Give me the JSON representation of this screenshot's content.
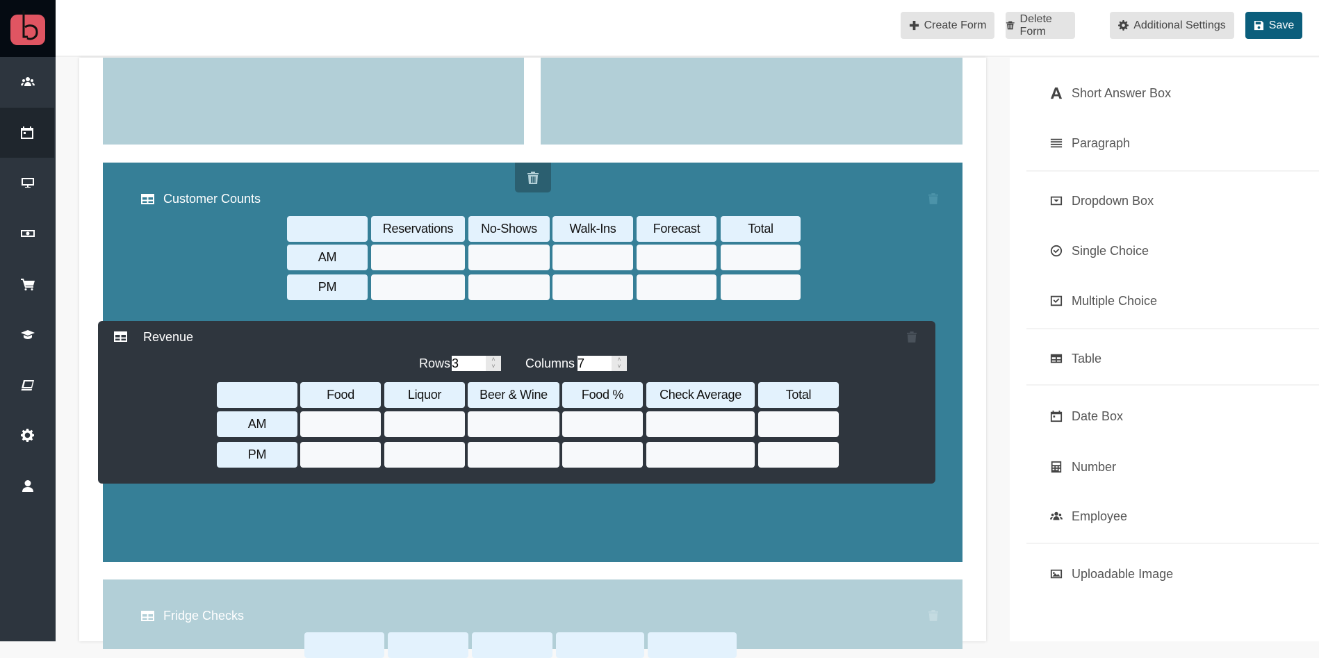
{
  "colors": {
    "sidebar": "#2d353e",
    "logo_bg": "#050b12",
    "brand": "#e05562",
    "primary": "#0b5e7c",
    "block_light": "#b2cfd7",
    "block_active": "#367f97",
    "block_dark": "#2f363e",
    "header_cell": "#e3f2fd"
  },
  "sidebar": {
    "items": [
      {
        "icon": "users-icon"
      },
      {
        "icon": "calendar-icon",
        "active": true
      },
      {
        "icon": "monitor-icon"
      },
      {
        "icon": "money-icon"
      },
      {
        "icon": "cart-icon"
      },
      {
        "icon": "graduation-cap-icon"
      },
      {
        "icon": "book-icon"
      },
      {
        "icon": "gear-icon"
      },
      {
        "icon": "user-icon"
      }
    ]
  },
  "toolbar": {
    "create": "Create Form",
    "delete": "Delete Form",
    "settings": "Additional Settings",
    "save": "Save"
  },
  "blocks": {
    "customer_counts": {
      "title": "Customer Counts",
      "headers": [
        "",
        "Reservations",
        "No-Shows",
        "Walk-Ins",
        "Forecast",
        "Total"
      ],
      "rows": [
        "AM",
        "PM"
      ]
    },
    "revenue": {
      "title": "Revenue",
      "rows_label": "Rows",
      "rows_value": "3",
      "columns_label": "Columns",
      "columns_value": "7",
      "headers": [
        "",
        "Food",
        "Liquor",
        "Beer & Wine",
        "Food %",
        "Check Average",
        "Total"
      ],
      "rows": [
        "AM",
        "PM"
      ]
    },
    "fridge_checks": {
      "title": "Fridge Checks"
    }
  },
  "palette": {
    "items": [
      {
        "label": "Short Answer Box",
        "icon": "font-icon"
      },
      {
        "label": "Paragraph",
        "icon": "align-justify-icon"
      },
      {
        "label": "Dropdown Box",
        "icon": "dropdown-icon"
      },
      {
        "label": "Single Choice",
        "icon": "check-circle-icon"
      },
      {
        "label": "Multiple Choice",
        "icon": "check-square-icon"
      },
      {
        "label": "Table",
        "icon": "table-icon"
      },
      {
        "label": "Date Box",
        "icon": "calendar-icon"
      },
      {
        "label": "Number",
        "icon": "calculator-icon"
      },
      {
        "label": "Employee",
        "icon": "users-icon"
      },
      {
        "label": "Uploadable Image",
        "icon": "image-icon"
      }
    ]
  }
}
